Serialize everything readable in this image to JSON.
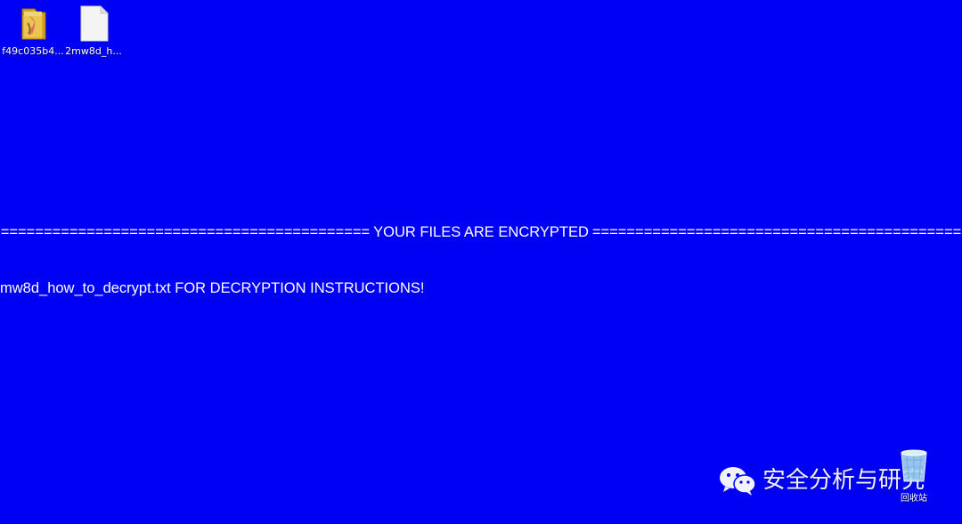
{
  "desktop": {
    "background_color": "#0000f5",
    "icons": [
      {
        "label": "f49c035b4...",
        "icon": "folder-icon"
      },
      {
        "label": "2mw8d_h...",
        "icon": "text-file-icon"
      },
      {
        "label": "回收站",
        "icon": "recycle-bin-icon"
      }
    ]
  },
  "ransom_note": {
    "banner_fill_left": "==========================================================================================================",
    "banner_title": "YOUR FILES ARE ENCRYPTED",
    "banner_fill_right": "==========================================================================================================",
    "instruction": "mw8d_how_to_decrypt.txt FOR DECRYPTION INSTRUCTIONS!"
  },
  "watermark": {
    "text": "安全分析与研究",
    "icon": "wechat-icon"
  }
}
